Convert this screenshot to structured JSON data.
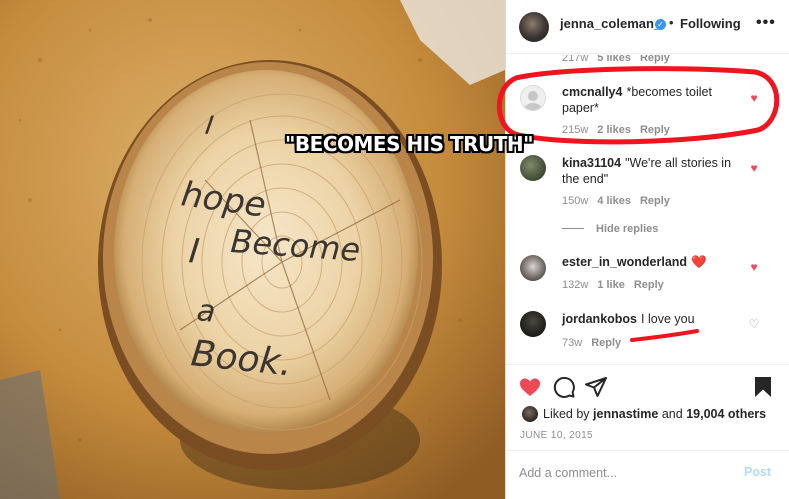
{
  "meme_caption": "\"BECOMES HIS TRUTH\"",
  "photo": {
    "description_icon": "tree-stump-photo",
    "handwriting": [
      "I",
      "hope",
      "I",
      "Become",
      "a",
      "Book."
    ]
  },
  "header": {
    "username": "jenna_coleman_",
    "verified_icon": "verified-badge-icon",
    "separator": "•",
    "follow_status": "Following",
    "more": "•••"
  },
  "comments": [
    {
      "username": "",
      "text": "",
      "meta": {
        "age": "217w",
        "likes": "5 likes",
        "reply": "Reply"
      }
    },
    {
      "username": "cmcnally4",
      "text": "*becomes toilet paper*",
      "meta": {
        "age": "215w",
        "likes": "2 likes",
        "reply": "Reply"
      },
      "liked": true
    },
    {
      "username": "kina31104",
      "text": "\"We're all stories in the end\"",
      "meta": {
        "age": "150w",
        "likes": "4 likes",
        "reply": "Reply"
      },
      "liked": true
    },
    {
      "username": "ester_in_wonderland",
      "text": "❤️",
      "meta": {
        "age": "132w",
        "likes": "1 like",
        "reply": "Reply"
      },
      "liked": true
    },
    {
      "username": "jordankobos",
      "text": "I love you",
      "meta": {
        "age": "73w",
        "likes": "",
        "reply": "Reply"
      },
      "liked": false
    }
  ],
  "hide_replies": "Hide replies",
  "actions": {
    "like_icon": "heart-filled-icon",
    "comment_icon": "comment-bubble-icon",
    "share_icon": "paper-plane-icon",
    "save_icon": "bookmark-filled-icon"
  },
  "likes": {
    "prefix": "Liked by",
    "user": "jennastime",
    "joiner": "and",
    "others": "19,004 others"
  },
  "date": "JUNE 10, 2015",
  "add_comment": {
    "placeholder": "Add a comment...",
    "post_label": "Post"
  },
  "colors": {
    "like_red": "#ed4956",
    "link_blue": "#3897f0",
    "post_disabled": "#b3dbff",
    "annotation_red": "#f0141e"
  }
}
